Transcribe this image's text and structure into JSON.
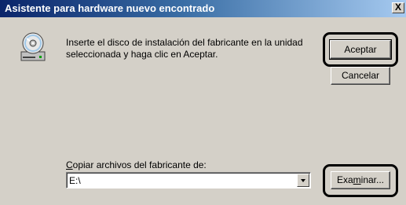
{
  "window": {
    "title": "Asistente para hardware nuevo encontrado",
    "close_glyph": "X"
  },
  "icons": {
    "disk": "cd-drive-icon",
    "close": "close-icon",
    "dropdown": "chevron-down-icon"
  },
  "message": "Inserte el disco de instalación del fabricante en la unidad seleccionada y haga clic en Aceptar.",
  "buttons": {
    "ok_label": "Aceptar",
    "cancel_label": "Cancelar",
    "browse_pre": "Exa",
    "browse_accel": "m",
    "browse_post": "inar..."
  },
  "copy_from": {
    "label_accel": "C",
    "label_rest": "opiar archivos del fabricante de:",
    "value": "E:\\"
  },
  "colors": {
    "title_start": "#0a246a",
    "title_end": "#a6caf0",
    "face": "#d4d0c8"
  }
}
